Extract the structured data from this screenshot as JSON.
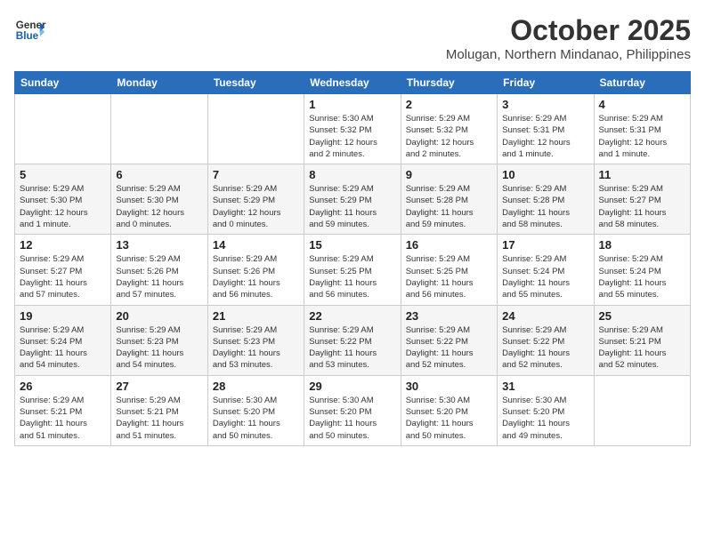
{
  "header": {
    "logo_line1": "General",
    "logo_line2": "Blue",
    "month": "October 2025",
    "location": "Molugan, Northern Mindanao, Philippines"
  },
  "weekdays": [
    "Sunday",
    "Monday",
    "Tuesday",
    "Wednesday",
    "Thursday",
    "Friday",
    "Saturday"
  ],
  "weeks": [
    [
      {
        "day": "",
        "info": ""
      },
      {
        "day": "",
        "info": ""
      },
      {
        "day": "",
        "info": ""
      },
      {
        "day": "1",
        "info": "Sunrise: 5:30 AM\nSunset: 5:32 PM\nDaylight: 12 hours\nand 2 minutes."
      },
      {
        "day": "2",
        "info": "Sunrise: 5:29 AM\nSunset: 5:32 PM\nDaylight: 12 hours\nand 2 minutes."
      },
      {
        "day": "3",
        "info": "Sunrise: 5:29 AM\nSunset: 5:31 PM\nDaylight: 12 hours\nand 1 minute."
      },
      {
        "day": "4",
        "info": "Sunrise: 5:29 AM\nSunset: 5:31 PM\nDaylight: 12 hours\nand 1 minute."
      }
    ],
    [
      {
        "day": "5",
        "info": "Sunrise: 5:29 AM\nSunset: 5:30 PM\nDaylight: 12 hours\nand 1 minute."
      },
      {
        "day": "6",
        "info": "Sunrise: 5:29 AM\nSunset: 5:30 PM\nDaylight: 12 hours\nand 0 minutes."
      },
      {
        "day": "7",
        "info": "Sunrise: 5:29 AM\nSunset: 5:29 PM\nDaylight: 12 hours\nand 0 minutes."
      },
      {
        "day": "8",
        "info": "Sunrise: 5:29 AM\nSunset: 5:29 PM\nDaylight: 11 hours\nand 59 minutes."
      },
      {
        "day": "9",
        "info": "Sunrise: 5:29 AM\nSunset: 5:28 PM\nDaylight: 11 hours\nand 59 minutes."
      },
      {
        "day": "10",
        "info": "Sunrise: 5:29 AM\nSunset: 5:28 PM\nDaylight: 11 hours\nand 58 minutes."
      },
      {
        "day": "11",
        "info": "Sunrise: 5:29 AM\nSunset: 5:27 PM\nDaylight: 11 hours\nand 58 minutes."
      }
    ],
    [
      {
        "day": "12",
        "info": "Sunrise: 5:29 AM\nSunset: 5:27 PM\nDaylight: 11 hours\nand 57 minutes."
      },
      {
        "day": "13",
        "info": "Sunrise: 5:29 AM\nSunset: 5:26 PM\nDaylight: 11 hours\nand 57 minutes."
      },
      {
        "day": "14",
        "info": "Sunrise: 5:29 AM\nSunset: 5:26 PM\nDaylight: 11 hours\nand 56 minutes."
      },
      {
        "day": "15",
        "info": "Sunrise: 5:29 AM\nSunset: 5:25 PM\nDaylight: 11 hours\nand 56 minutes."
      },
      {
        "day": "16",
        "info": "Sunrise: 5:29 AM\nSunset: 5:25 PM\nDaylight: 11 hours\nand 56 minutes."
      },
      {
        "day": "17",
        "info": "Sunrise: 5:29 AM\nSunset: 5:24 PM\nDaylight: 11 hours\nand 55 minutes."
      },
      {
        "day": "18",
        "info": "Sunrise: 5:29 AM\nSunset: 5:24 PM\nDaylight: 11 hours\nand 55 minutes."
      }
    ],
    [
      {
        "day": "19",
        "info": "Sunrise: 5:29 AM\nSunset: 5:24 PM\nDaylight: 11 hours\nand 54 minutes."
      },
      {
        "day": "20",
        "info": "Sunrise: 5:29 AM\nSunset: 5:23 PM\nDaylight: 11 hours\nand 54 minutes."
      },
      {
        "day": "21",
        "info": "Sunrise: 5:29 AM\nSunset: 5:23 PM\nDaylight: 11 hours\nand 53 minutes."
      },
      {
        "day": "22",
        "info": "Sunrise: 5:29 AM\nSunset: 5:22 PM\nDaylight: 11 hours\nand 53 minutes."
      },
      {
        "day": "23",
        "info": "Sunrise: 5:29 AM\nSunset: 5:22 PM\nDaylight: 11 hours\nand 52 minutes."
      },
      {
        "day": "24",
        "info": "Sunrise: 5:29 AM\nSunset: 5:22 PM\nDaylight: 11 hours\nand 52 minutes."
      },
      {
        "day": "25",
        "info": "Sunrise: 5:29 AM\nSunset: 5:21 PM\nDaylight: 11 hours\nand 52 minutes."
      }
    ],
    [
      {
        "day": "26",
        "info": "Sunrise: 5:29 AM\nSunset: 5:21 PM\nDaylight: 11 hours\nand 51 minutes."
      },
      {
        "day": "27",
        "info": "Sunrise: 5:29 AM\nSunset: 5:21 PM\nDaylight: 11 hours\nand 51 minutes."
      },
      {
        "day": "28",
        "info": "Sunrise: 5:30 AM\nSunset: 5:20 PM\nDaylight: 11 hours\nand 50 minutes."
      },
      {
        "day": "29",
        "info": "Sunrise: 5:30 AM\nSunset: 5:20 PM\nDaylight: 11 hours\nand 50 minutes."
      },
      {
        "day": "30",
        "info": "Sunrise: 5:30 AM\nSunset: 5:20 PM\nDaylight: 11 hours\nand 50 minutes."
      },
      {
        "day": "31",
        "info": "Sunrise: 5:30 AM\nSunset: 5:20 PM\nDaylight: 11 hours\nand 49 minutes."
      },
      {
        "day": "",
        "info": ""
      }
    ]
  ]
}
